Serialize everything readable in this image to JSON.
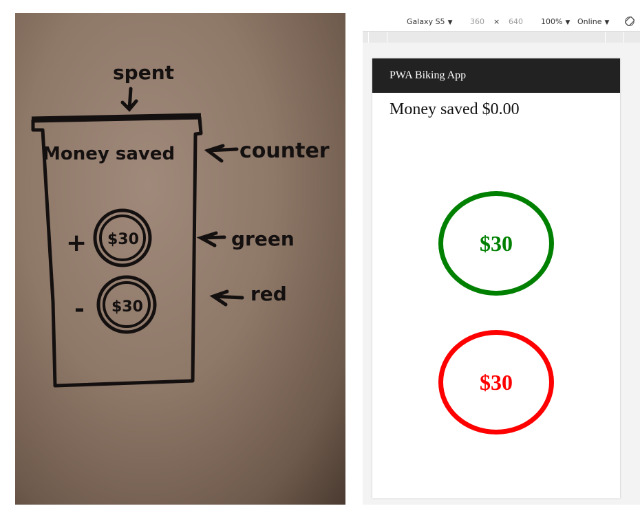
{
  "sketch": {
    "spent_label": "spent",
    "screen_header": "Money saved",
    "counter_note": "counter",
    "green_note": "green",
    "red_note": "red",
    "plus_sign": "+",
    "minus_sign": "-",
    "top_button_text": "$30",
    "bottom_button_text": "$30"
  },
  "devtools": {
    "device": "Galaxy S5",
    "width": "360",
    "times": "×",
    "height": "640",
    "zoom": "100%",
    "network": "Online",
    "caret": "▼"
  },
  "app": {
    "title": "PWA Biking App",
    "counter_text": "Money saved $0.00",
    "save_button": "$30",
    "spend_button": "$30",
    "colors": {
      "save": "#008000",
      "spend": "#ff0000",
      "appbar": "#222222"
    }
  }
}
